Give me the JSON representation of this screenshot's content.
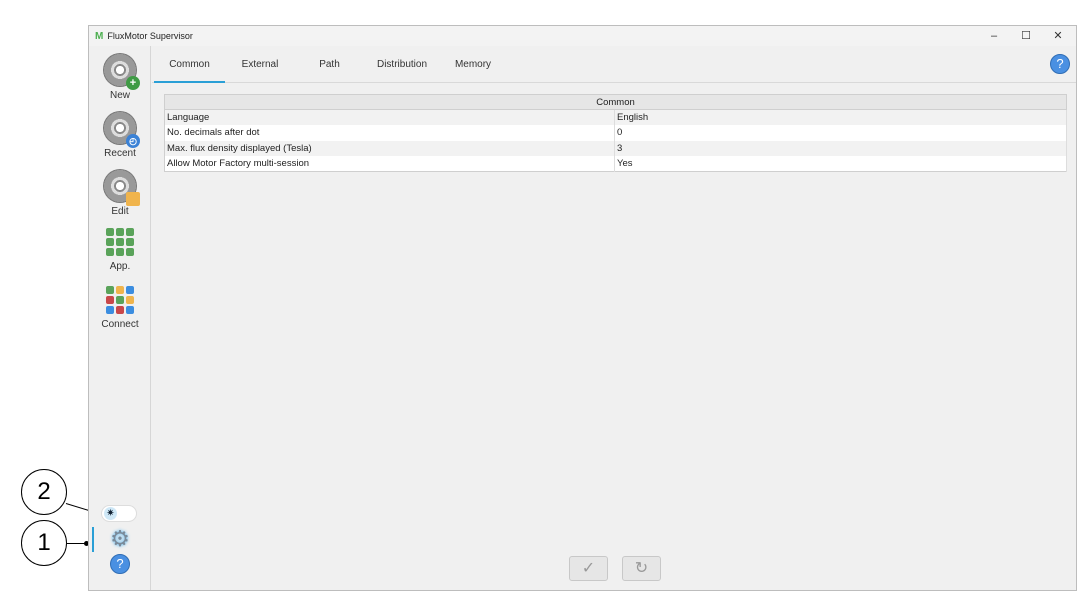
{
  "window": {
    "title": "FluxMotor Supervisor",
    "minimize": "–",
    "maximize": "☐",
    "close": "✕"
  },
  "sidebar": {
    "items": [
      {
        "label": "New"
      },
      {
        "label": "Recent"
      },
      {
        "label": "Edit"
      },
      {
        "label": "App."
      },
      {
        "label": "Connect"
      }
    ]
  },
  "tabs": [
    {
      "label": "Common"
    },
    {
      "label": "External"
    },
    {
      "label": "Path"
    },
    {
      "label": "Distribution"
    },
    {
      "label": "Memory"
    }
  ],
  "help_label": "?",
  "table": {
    "header": "Common",
    "rows": [
      {
        "name": "Language",
        "value": "English"
      },
      {
        "name": "No. decimals after dot",
        "value": "0"
      },
      {
        "name": "Max. flux density displayed (Tesla)",
        "value": "3"
      },
      {
        "name": "Allow Motor Factory multi-session",
        "value": "Yes"
      }
    ]
  },
  "buttons": {
    "apply": "✓",
    "reset": "↻"
  },
  "annotations": [
    "1",
    "2"
  ],
  "colors": {
    "accent": "#2a9fd6",
    "help": "#4a90e2"
  }
}
